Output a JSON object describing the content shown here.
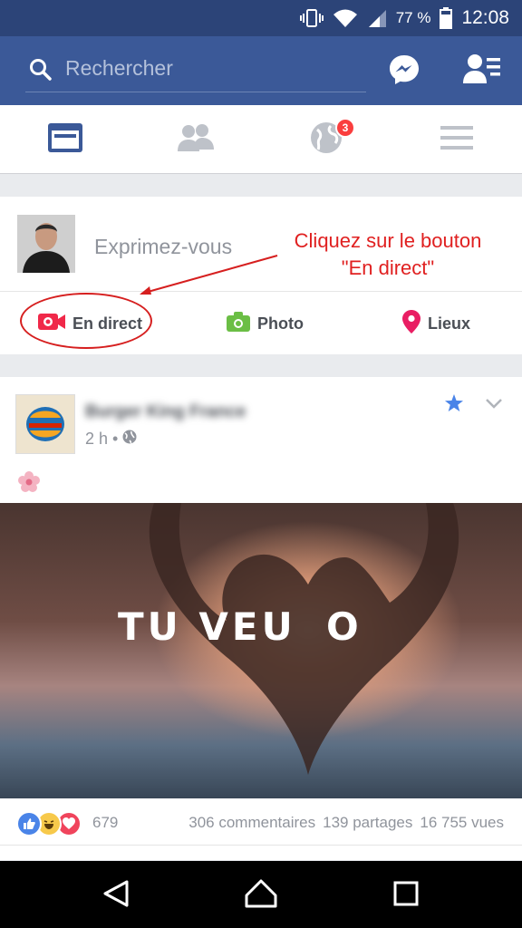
{
  "status_bar": {
    "battery": "77 %",
    "time": "12:08"
  },
  "search": {
    "placeholder": "Rechercher"
  },
  "nav_tabs": {
    "notification_badge": "3"
  },
  "composer": {
    "placeholder": "Exprimez-vous",
    "actions": [
      {
        "label": "En direct",
        "icon": "live-video-icon",
        "color": "#f02849"
      },
      {
        "label": "Photo",
        "icon": "camera-icon",
        "color": "#6bbe45"
      },
      {
        "label": "Lieux",
        "icon": "location-pin-icon",
        "color": "#e91e63"
      }
    ]
  },
  "annotation": {
    "line1": "Cliquez sur le bouton",
    "line2": "\"En direct\""
  },
  "post": {
    "page_name": "Burger King France",
    "time": "2 h",
    "image_text_left": "TU VEU",
    "image_text_right": "O",
    "reaction_count": "679",
    "comments": "306 commentaires",
    "shares": "139 partages",
    "views": "16 755 vues"
  },
  "colors": {
    "brand": "#3b5998",
    "status_bar": "#2c4478",
    "annotation": "#e02020"
  }
}
